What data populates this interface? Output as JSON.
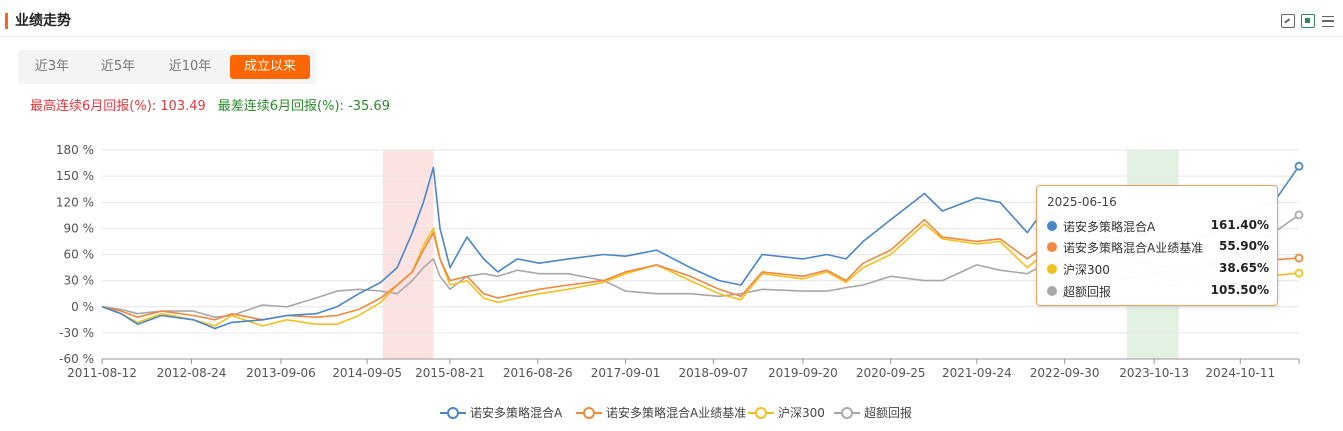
{
  "header": {
    "title": "业绩走势"
  },
  "tools": [
    {
      "name": "chart-zoom-icon"
    },
    {
      "name": "excel-export-icon"
    },
    {
      "name": "list-icon"
    }
  ],
  "tabs": [
    {
      "label": "近3年",
      "active": false
    },
    {
      "label": "近5年",
      "active": false
    },
    {
      "label": "近10年",
      "active": false
    },
    {
      "label": "成立以来",
      "active": true
    }
  ],
  "stats": {
    "best_label": "最高连续6月回报(%): ",
    "best_value": "103.49",
    "worst_label": "最差连续6月回报(%): ",
    "worst_value": "-35.69"
  },
  "colors": {
    "fund": "#4a86c8",
    "benchmark": "#f0883e",
    "index": "#f5c01d",
    "excess": "#a8a8a8",
    "band_red": "#fde2e2",
    "band_green": "#e3f1e3"
  },
  "chart_data": {
    "type": "line",
    "x_ticks": [
      "2011-08-12",
      "2012-08-24",
      "2013-09-06",
      "2014-09-05",
      "2015-08-21",
      "2016-08-26",
      "2017-09-01",
      "2018-09-07",
      "2019-09-20",
      "2020-09-25",
      "2021-09-24",
      "2022-09-30",
      "2023-10-13",
      "2024-10-11"
    ],
    "y_ticks": [
      "180 %",
      "150 %",
      "120 %",
      "90 %",
      "60 %",
      "30 %",
      "0 %",
      "-30 %",
      "-60 %"
    ],
    "ylim": [
      -60,
      180
    ],
    "xlim": [
      "2011-08-12",
      "2025-06-16"
    ],
    "grid": true,
    "legend_position": "bottom",
    "highlight_bands": [
      {
        "from": "2014-11-10",
        "to": "2015-06-12",
        "color": "red"
      },
      {
        "from": "2023-06-20",
        "to": "2024-01-25",
        "color": "green"
      }
    ],
    "series": [
      {
        "name": "诺安多策略混合A",
        "color_key": "fund",
        "points": [
          [
            "2011-08-12",
            0
          ],
          [
            "2011-11-01",
            -8
          ],
          [
            "2012-01-10",
            -20
          ],
          [
            "2012-04-20",
            -10
          ],
          [
            "2012-09-01",
            -15
          ],
          [
            "2012-12-01",
            -25
          ],
          [
            "2013-02-10",
            -18
          ],
          [
            "2013-06-20",
            -15
          ],
          [
            "2013-10-01",
            -10
          ],
          [
            "2014-02-01",
            -8
          ],
          [
            "2014-05-01",
            0
          ],
          [
            "2014-08-01",
            15
          ],
          [
            "2014-11-01",
            28
          ],
          [
            "2015-01-10",
            45
          ],
          [
            "2015-03-15",
            85
          ],
          [
            "2015-05-01",
            120
          ],
          [
            "2015-06-12",
            160
          ],
          [
            "2015-07-10",
            90
          ],
          [
            "2015-08-21",
            45
          ],
          [
            "2015-11-01",
            80
          ],
          [
            "2016-01-10",
            55
          ],
          [
            "2016-03-10",
            40
          ],
          [
            "2016-06-01",
            55
          ],
          [
            "2016-09-01",
            50
          ],
          [
            "2017-01-01",
            55
          ],
          [
            "2017-06-01",
            60
          ],
          [
            "2017-09-01",
            58
          ],
          [
            "2018-01-10",
            65
          ],
          [
            "2018-06-01",
            45
          ],
          [
            "2018-10-01",
            30
          ],
          [
            "2019-01-01",
            25
          ],
          [
            "2019-04-01",
            60
          ],
          [
            "2019-09-20",
            55
          ],
          [
            "2019-12-31",
            60
          ],
          [
            "2020-03-20",
            55
          ],
          [
            "2020-06-01",
            75
          ],
          [
            "2020-09-25",
            100
          ],
          [
            "2021-02-15",
            130
          ],
          [
            "2021-05-01",
            110
          ],
          [
            "2021-09-24",
            125
          ],
          [
            "2021-12-31",
            120
          ],
          [
            "2022-04-25",
            85
          ],
          [
            "2022-07-01",
            110
          ],
          [
            "2022-09-30",
            100
          ],
          [
            "2022-12-31",
            90
          ],
          [
            "2023-04-01",
            80
          ],
          [
            "2023-10-13",
            70
          ],
          [
            "2024-02-05",
            65
          ],
          [
            "2024-05-01",
            80
          ],
          [
            "2024-10-11",
            100
          ],
          [
            "2025-01-01",
            115
          ],
          [
            "2025-03-01",
            120
          ],
          [
            "2025-06-16",
            161.4
          ]
        ]
      },
      {
        "name": "诺安多策略混合A业绩基准",
        "color_key": "benchmark",
        "points": [
          [
            "2011-08-12",
            0
          ],
          [
            "2011-11-01",
            -5
          ],
          [
            "2012-01-10",
            -12
          ],
          [
            "2012-04-20",
            -5
          ],
          [
            "2012-09-01",
            -10
          ],
          [
            "2012-12-01",
            -15
          ],
          [
            "2013-02-10",
            -8
          ],
          [
            "2013-06-20",
            -15
          ],
          [
            "2013-10-01",
            -10
          ],
          [
            "2014-02-01",
            -12
          ],
          [
            "2014-05-01",
            -10
          ],
          [
            "2014-08-01",
            -3
          ],
          [
            "2014-11-01",
            10
          ],
          [
            "2015-01-10",
            25
          ],
          [
            "2015-03-15",
            40
          ],
          [
            "2015-05-01",
            65
          ],
          [
            "2015-06-12",
            85
          ],
          [
            "2015-07-10",
            55
          ],
          [
            "2015-08-21",
            30
          ],
          [
            "2015-11-01",
            35
          ],
          [
            "2016-01-10",
            15
          ],
          [
            "2016-03-10",
            10
          ],
          [
            "2016-06-01",
            15
          ],
          [
            "2016-09-01",
            20
          ],
          [
            "2017-01-01",
            25
          ],
          [
            "2017-06-01",
            30
          ],
          [
            "2017-09-01",
            40
          ],
          [
            "2018-01-10",
            48
          ],
          [
            "2018-06-01",
            35
          ],
          [
            "2018-10-01",
            20
          ],
          [
            "2019-01-01",
            12
          ],
          [
            "2019-04-01",
            40
          ],
          [
            "2019-09-20",
            35
          ],
          [
            "2019-12-31",
            42
          ],
          [
            "2020-03-20",
            30
          ],
          [
            "2020-06-01",
            50
          ],
          [
            "2020-09-25",
            65
          ],
          [
            "2021-02-15",
            100
          ],
          [
            "2021-05-01",
            80
          ],
          [
            "2021-09-24",
            75
          ],
          [
            "2021-12-31",
            78
          ],
          [
            "2022-04-25",
            55
          ],
          [
            "2022-07-01",
            68
          ],
          [
            "2022-09-30",
            50
          ],
          [
            "2022-12-31",
            55
          ],
          [
            "2023-04-01",
            58
          ],
          [
            "2023-10-13",
            48
          ],
          [
            "2024-02-05",
            42
          ],
          [
            "2024-05-01",
            50
          ],
          [
            "2024-10-11",
            58
          ],
          [
            "2025-01-01",
            55
          ],
          [
            "2025-03-01",
            54
          ],
          [
            "2025-06-16",
            55.9
          ]
        ]
      },
      {
        "name": "沪深300",
        "color_key": "index",
        "points": [
          [
            "2011-08-12",
            0
          ],
          [
            "2011-11-01",
            -8
          ],
          [
            "2012-01-10",
            -18
          ],
          [
            "2012-04-20",
            -8
          ],
          [
            "2012-09-01",
            -15
          ],
          [
            "2012-12-01",
            -22
          ],
          [
            "2013-02-10",
            -10
          ],
          [
            "2013-06-20",
            -22
          ],
          [
            "2013-10-01",
            -15
          ],
          [
            "2014-02-01",
            -20
          ],
          [
            "2014-05-01",
            -20
          ],
          [
            "2014-08-01",
            -10
          ],
          [
            "2014-11-01",
            5
          ],
          [
            "2015-01-10",
            25
          ],
          [
            "2015-03-15",
            40
          ],
          [
            "2015-05-01",
            70
          ],
          [
            "2015-06-12",
            90
          ],
          [
            "2015-07-10",
            55
          ],
          [
            "2015-08-21",
            25
          ],
          [
            "2015-11-01",
            30
          ],
          [
            "2016-01-10",
            10
          ],
          [
            "2016-03-10",
            5
          ],
          [
            "2016-06-01",
            10
          ],
          [
            "2016-09-01",
            15
          ],
          [
            "2017-01-01",
            20
          ],
          [
            "2017-06-01",
            28
          ],
          [
            "2017-09-01",
            38
          ],
          [
            "2018-01-10",
            48
          ],
          [
            "2018-06-01",
            30
          ],
          [
            "2018-10-01",
            15
          ],
          [
            "2019-01-01",
            8
          ],
          [
            "2019-04-01",
            38
          ],
          [
            "2019-09-20",
            32
          ],
          [
            "2019-12-31",
            40
          ],
          [
            "2020-03-20",
            28
          ],
          [
            "2020-06-01",
            45
          ],
          [
            "2020-09-25",
            60
          ],
          [
            "2021-02-15",
            95
          ],
          [
            "2021-05-01",
            78
          ],
          [
            "2021-09-24",
            72
          ],
          [
            "2021-12-31",
            75
          ],
          [
            "2022-04-25",
            45
          ],
          [
            "2022-07-01",
            60
          ],
          [
            "2022-09-30",
            40
          ],
          [
            "2022-12-31",
            45
          ],
          [
            "2023-04-01",
            48
          ],
          [
            "2023-10-13",
            30
          ],
          [
            "2024-02-05",
            22
          ],
          [
            "2024-05-01",
            32
          ],
          [
            "2024-10-11",
            42
          ],
          [
            "2025-01-01",
            38
          ],
          [
            "2025-03-01",
            36
          ],
          [
            "2025-06-16",
            38.65
          ]
        ]
      },
      {
        "name": "超额回报",
        "color_key": "excess",
        "points": [
          [
            "2011-08-12",
            0
          ],
          [
            "2011-11-01",
            -3
          ],
          [
            "2012-01-10",
            -8
          ],
          [
            "2012-04-20",
            -5
          ],
          [
            "2012-09-01",
            -5
          ],
          [
            "2012-12-01",
            -12
          ],
          [
            "2013-02-10",
            -10
          ],
          [
            "2013-06-20",
            2
          ],
          [
            "2013-10-01",
            0
          ],
          [
            "2014-02-01",
            10
          ],
          [
            "2014-05-01",
            18
          ],
          [
            "2014-08-01",
            20
          ],
          [
            "2014-11-01",
            18
          ],
          [
            "2015-01-10",
            15
          ],
          [
            "2015-03-15",
            30
          ],
          [
            "2015-05-01",
            45
          ],
          [
            "2015-06-12",
            55
          ],
          [
            "2015-07-10",
            35
          ],
          [
            "2015-08-21",
            20
          ],
          [
            "2015-11-01",
            35
          ],
          [
            "2016-01-10",
            38
          ],
          [
            "2016-03-10",
            35
          ],
          [
            "2016-06-01",
            42
          ],
          [
            "2016-09-01",
            38
          ],
          [
            "2017-01-01",
            38
          ],
          [
            "2017-06-01",
            30
          ],
          [
            "2017-09-01",
            18
          ],
          [
            "2018-01-10",
            15
          ],
          [
            "2018-06-01",
            15
          ],
          [
            "2018-10-01",
            12
          ],
          [
            "2019-01-01",
            15
          ],
          [
            "2019-04-01",
            20
          ],
          [
            "2019-09-20",
            18
          ],
          [
            "2019-12-31",
            18
          ],
          [
            "2020-03-20",
            22
          ],
          [
            "2020-06-01",
            25
          ],
          [
            "2020-09-25",
            35
          ],
          [
            "2021-02-15",
            30
          ],
          [
            "2021-05-01",
            30
          ],
          [
            "2021-09-24",
            48
          ],
          [
            "2021-12-31",
            42
          ],
          [
            "2022-04-25",
            38
          ],
          [
            "2022-07-01",
            48
          ],
          [
            "2022-09-30",
            58
          ],
          [
            "2022-12-31",
            42
          ],
          [
            "2023-04-01",
            30
          ],
          [
            "2023-10-13",
            38
          ],
          [
            "2024-02-05",
            40
          ],
          [
            "2024-05-01",
            45
          ],
          [
            "2024-10-11",
            55
          ],
          [
            "2025-01-01",
            75
          ],
          [
            "2025-03-01",
            85
          ],
          [
            "2025-06-16",
            105.5
          ]
        ]
      }
    ]
  },
  "tooltip": {
    "date": "2025-06-16",
    "rows": [
      {
        "label": "诺安多策略混合A",
        "value": "161.40%",
        "color_key": "fund"
      },
      {
        "label": "诺安多策略混合A业绩基准",
        "value": "55.90%",
        "color_key": "benchmark"
      },
      {
        "label": "沪深300",
        "value": "38.65%",
        "color_key": "index"
      },
      {
        "label": "超额回报",
        "value": "105.50%",
        "color_key": "excess"
      }
    ]
  },
  "legend": [
    {
      "label": "诺安多策略混合A",
      "color_key": "fund"
    },
    {
      "label": "诺安多策略混合A业绩基准",
      "color_key": "benchmark"
    },
    {
      "label": "沪深300",
      "color_key": "index"
    },
    {
      "label": "超额回报",
      "color_key": "excess"
    }
  ]
}
